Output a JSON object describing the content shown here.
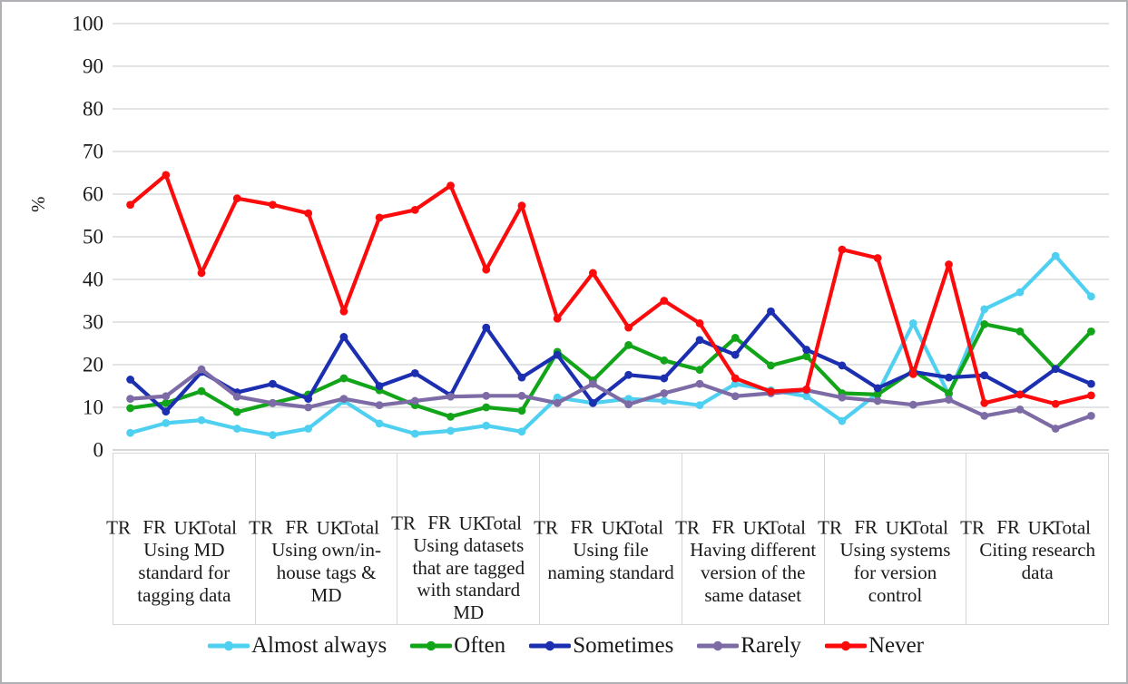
{
  "axis": {
    "y_label": "%",
    "y_ticks": [
      0,
      10,
      20,
      30,
      40,
      50,
      60,
      70,
      80,
      90,
      100
    ],
    "category_labels": [
      "TR",
      "FR",
      "UK",
      "Total"
    ]
  },
  "groups": [
    "Using MD standard for tagging data",
    "Using own/in-house tags & MD",
    "Using datasets that are tagged with standard MD",
    "Using file naming standard",
    "Having different version of the same dataset",
    "Using systems for version control",
    "Citing research data"
  ],
  "legend": [
    {
      "label": "Almost always",
      "color": "#4FD0F0"
    },
    {
      "label": "Often",
      "color": "#12A419"
    },
    {
      "label": "Sometimes",
      "color": "#1B2FB0"
    },
    {
      "label": "Rarely",
      "color": "#7D6BA6"
    },
    {
      "label": "Never",
      "color": "#FB0B0B"
    }
  ],
  "chart_data": {
    "type": "line",
    "title": "",
    "xlabel": "",
    "ylabel": "%",
    "ylim": [
      0,
      100
    ],
    "ytick_step": 10,
    "grid": true,
    "legend_position": "bottom",
    "groups": [
      "Using MD standard for tagging data",
      "Using own/in-house tags & MD",
      "Using datasets that are tagged with standard MD",
      "Using file naming standard",
      "Having different version of the same dataset",
      "Using systems for version control",
      "Citing research data"
    ],
    "categories": [
      "TR",
      "FR",
      "UK",
      "Total"
    ],
    "x": [
      "Using MD standard for tagging data / TR",
      "Using MD standard for tagging data / FR",
      "Using MD standard for tagging data / UK",
      "Using MD standard for tagging data / Total",
      "Using own/in-house tags & MD / TR",
      "Using own/in-house tags & MD / FR",
      "Using own/in-house tags & MD / UK",
      "Using own/in-house tags & MD / Total",
      "Using datasets that are tagged with standard MD / TR",
      "Using datasets that are tagged with standard MD / FR",
      "Using datasets that are tagged with standard MD / UK",
      "Using datasets that are tagged with standard MD / Total",
      "Using file naming standard / TR",
      "Using file naming standard / FR",
      "Using file naming standard / UK",
      "Using file naming standard / Total",
      "Having different version of the same dataset / TR",
      "Having different version of the same dataset / FR",
      "Having different version of the same dataset / UK",
      "Having different version of the same dataset / Total",
      "Using systems for version control / TR",
      "Using systems for version control / FR",
      "Using systems for version control / UK",
      "Using systems for version control / Total",
      "Citing research data / TR",
      "Citing research data / FR",
      "Citing research data / UK",
      "Citing research data / Total"
    ],
    "series": [
      {
        "name": "Almost always",
        "color": "#4FD0F0",
        "values": [
          4.0,
          6.3,
          7.0,
          5.0,
          3.5,
          5.0,
          11.5,
          6.2,
          3.8,
          4.5,
          5.7,
          4.3,
          12.3,
          11.0,
          12.0,
          11.5,
          10.5,
          15.5,
          14.0,
          12.6,
          6.8,
          13.3,
          29.7,
          13.0,
          33.0,
          37.0,
          45.5,
          36.0
        ]
      },
      {
        "name": "Often",
        "color": "#12A419",
        "values": [
          9.8,
          11.0,
          13.8,
          8.9,
          11.0,
          13.0,
          16.8,
          14.0,
          10.5,
          7.8,
          10.0,
          9.2,
          23.0,
          16.3,
          24.6,
          21.0,
          18.8,
          26.3,
          19.8,
          22.0,
          13.3,
          13.0,
          18.6,
          13.3,
          29.5,
          27.8,
          19.0,
          27.8
        ]
      },
      {
        "name": "Sometimes",
        "color": "#1B2FB0",
        "values": [
          16.5,
          9.0,
          18.3,
          13.5,
          15.5,
          12.0,
          26.5,
          15.0,
          18.0,
          12.8,
          28.7,
          17.0,
          22.3,
          11.0,
          17.6,
          16.8,
          25.8,
          22.3,
          32.5,
          23.5,
          19.8,
          14.5,
          18.3,
          17.0,
          17.5,
          13.0,
          19.0,
          15.5
        ]
      },
      {
        "name": "Rarely",
        "color": "#7D6BA6",
        "values": [
          12.0,
          12.6,
          18.9,
          12.5,
          11.0,
          10.0,
          12.0,
          10.5,
          11.5,
          12.5,
          12.7,
          12.7,
          11.0,
          15.5,
          10.7,
          13.3,
          15.5,
          12.6,
          13.3,
          14.0,
          12.3,
          11.5,
          10.6,
          11.8,
          8.0,
          9.5,
          5.0,
          8.0
        ]
      },
      {
        "name": "Never",
        "color": "#FB0B0B",
        "values": [
          57.5,
          64.5,
          41.5,
          59.0,
          57.5,
          55.5,
          32.5,
          54.5,
          56.3,
          62.0,
          42.3,
          57.3,
          30.8,
          41.5,
          28.7,
          35.0,
          29.7,
          16.8,
          13.7,
          14.2,
          47.0,
          45.0,
          17.8,
          43.5,
          11.0,
          13.0,
          10.8,
          12.8
        ]
      }
    ]
  }
}
